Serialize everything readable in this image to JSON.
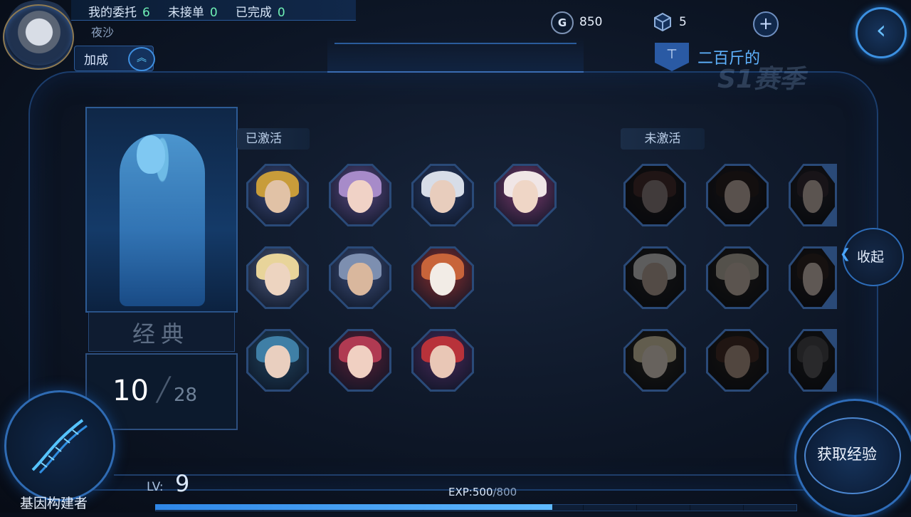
{
  "topbar": {
    "stats": [
      {
        "label": "我的委托",
        "value": "6"
      },
      {
        "label": "未接单",
        "value": "0"
      },
      {
        "label": "已完成",
        "value": "0"
      }
    ],
    "player_name": "夜沙",
    "bonus_label": "加成",
    "currencies": [
      {
        "icon": "G",
        "value": "850"
      },
      {
        "icon": "cube",
        "value": "5"
      }
    ]
  },
  "season": {
    "name": "二百斤的",
    "label": "S1赛季"
  },
  "hero_panel": {
    "category": "经典",
    "count_current": "10",
    "count_total": "28"
  },
  "sections": {
    "active_title": "已激活",
    "inactive_title": "未激活"
  },
  "active_heroes": [
    {
      "hair": "#c89c3a",
      "skin": "#e1c2a6",
      "bg": "#3d4a7a"
    },
    {
      "hair": "#a78bc9",
      "skin": "#f0d2c6",
      "bg": "#5b4a82"
    },
    {
      "hair": "#d7dde8",
      "skin": "#e8cdbd",
      "bg": "#2b3c66"
    },
    {
      "hair": "#f0e6e6",
      "skin": "#efd6c6",
      "bg": "#7a3a6c"
    },
    {
      "hair": "#e8d49a",
      "skin": "#edd4c0",
      "bg": "#4d5a7e"
    },
    {
      "hair": "#7d8fb0",
      "skin": "#d9b79d",
      "bg": "#3f4f7a"
    },
    {
      "hair": "#c8643a",
      "skin": "#f2ece6",
      "bg": "#8a2f2f"
    },
    {
      "hair": "#3f7fa6",
      "skin": "#e9cfbf",
      "bg": "#22445e"
    },
    {
      "hair": "#b03a52",
      "skin": "#f0d0c2",
      "bg": "#5a2036"
    },
    {
      "hair": "#b8323a",
      "skin": "#e9c7b6",
      "bg": "#4a2a5a"
    }
  ],
  "inactive_heroes": [
    {
      "hair": "#5a2a2a",
      "skin": "#9d7f80",
      "bg": "#2a2024"
    },
    {
      "hair": "#302020",
      "skin": "#d6b0a0",
      "bg": "#2c2430"
    },
    {
      "hair": "#3a2a3a",
      "skin": "#d7b7a7",
      "bg": "#2b2b3b"
    },
    {
      "hair": "#cfcfcf",
      "skin": "#c6a48e",
      "bg": "#2a2a2e"
    },
    {
      "hair": "#c2b49a",
      "skin": "#d7b9a2",
      "bg": "#2f2a26"
    },
    {
      "hair": "#3a2420",
      "skin": "#e0c0b0",
      "bg": "#302428"
    },
    {
      "hair": "#e6cf8a",
      "skin": "#eed8c2",
      "bg": "#3a3628"
    },
    {
      "hair": "#5a2a1e",
      "skin": "#c8987a",
      "bg": "#332620"
    },
    {
      "hair": "#4a4a52",
      "skin": "#5a5a66",
      "bg": "#26262e"
    }
  ],
  "collapse_label": "收起",
  "bottom": {
    "title": "基因构建者",
    "lv_label": "LV:",
    "lv_value": "9",
    "exp_label": "EXP:500",
    "exp_max": "/800",
    "exp_fraction": 0.62,
    "get_exp_label": "获取经验"
  },
  "colors": {
    "accent": "#3c90e0",
    "stat_value": "#6ff0b5"
  }
}
